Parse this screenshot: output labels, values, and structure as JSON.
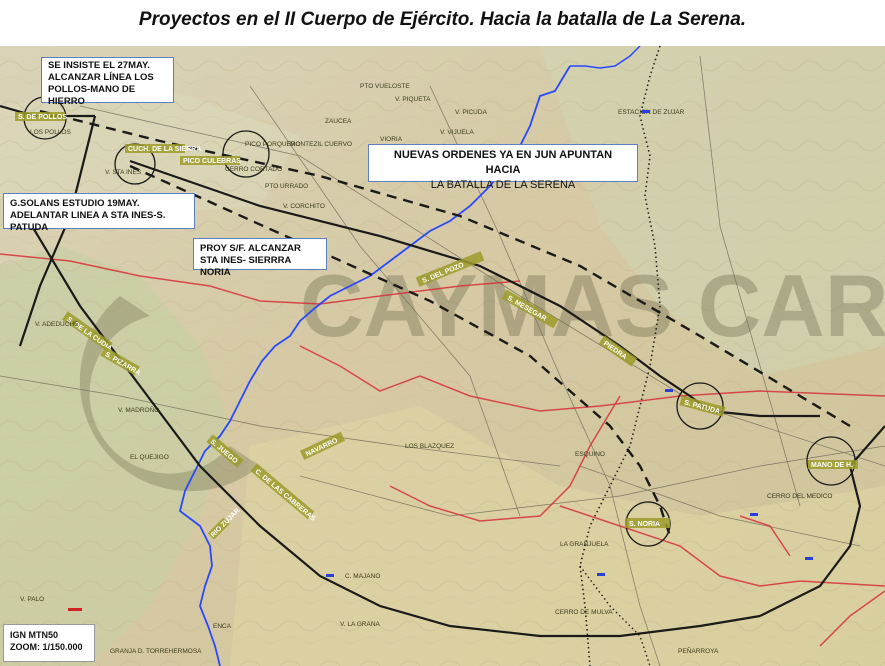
{
  "title": "Proyectos en el II Cuerpo de Ejército. Hacia la batalla de La Serena.",
  "annotations": {
    "box_27may": [
      "SE INSISTE EL   27MAY.",
      "ALCANZAR LÍNEA LOS",
      "POLLOS-MANO DE HIERRO"
    ],
    "box_solans": [
      "G.SOLANS ESTUDIO  19MAY.",
      "ADELANTAR LINEA A STA INES-S. PATUDA"
    ],
    "box_proy": [
      "PROY S/F. ALCANZAR",
      "STA INES- SIERRRA NORIA"
    ],
    "box_ordenes": [
      "NUEVAS ORDENES YA EN JUN APUNTAN HACIA",
      "LA BATALLA DE LA SERENA"
    ]
  },
  "scale": [
    "IGN MTN50",
    "ZOOM: 1/150.000"
  ],
  "watermark": "CAYMAS CARRAFIOS",
  "place_labels": {
    "pollos": "S. DE POLLOS",
    "los_pollos": "LOS POLLOS",
    "sta_ines": "V. STA INES",
    "sierra": "CUCH. DE LA SIERRA",
    "culebras": "PICO CULEBRAS",
    "porquero": "PICO PORQUERO",
    "cortado": "CERRO CORTADO",
    "urrado": "PTO URRADO",
    "corchito": "V. CORCHITO",
    "vijuela": "V. VIJUELA",
    "picuda": "V. PICUDA",
    "zuaar": "ESTACION DE ZUJAR",
    "zaucea": "ZAUCEA",
    "fcuervo": "MONTEZIL CUERVO",
    "delpozo": "S. DEL POZO",
    "mesegar": "S. MESEGAR",
    "patuda": "S. PATUDA",
    "piedra": "PIEDRA",
    "mano": "MANO DE H.",
    "noria": "S. NORIA",
    "granjuela": "LA GRANJUELA",
    "navarro": "NAVARRO",
    "blazquez": "LOS BLAZQUEZ",
    "esquino": "ESQUINO",
    "adeduche": "V. ADEDUCHE",
    "madrono": "V. MADROÑO",
    "quejigo": "EL QUEJIGO",
    "cdmedico": "CERRO DEL MEDICO",
    "mulva": "CERRO DE MULVA",
    "lagrana": "V. LA GRANA",
    "penarroya": "PEÑARROYA",
    "granja": "GRANJA D. TORREHERMOSA",
    "majano": "C. MAJANO",
    "vpalo": "V. PALO",
    "enca": "ENCA",
    "zujar_rio": "RIO ZUJAR",
    "vueloste": "PTO VUELOSTE",
    "piqueta": "V. PIQUETA",
    "lacudia": "S. DE LA CUDIA",
    "vioria": "VIORIA",
    "juego": "S. JUEGO",
    "cabreras": "C. DE LAS CABRERAS",
    "pizarra": "S. PIZARRA"
  }
}
